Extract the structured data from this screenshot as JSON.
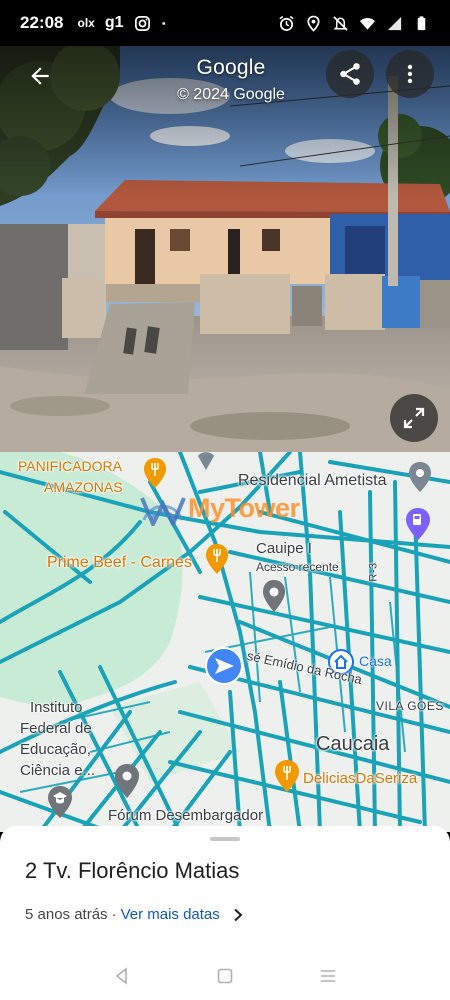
{
  "status_bar": {
    "time": "22:08",
    "apps": [
      "olx",
      "g1"
    ],
    "icons": [
      "olx-icon",
      "g1-icon",
      "instagram-icon",
      "dot-icon",
      "alarm-icon",
      "location-icon",
      "mute-icon",
      "wifi-icon",
      "signal-icon",
      "battery-icon"
    ]
  },
  "street_view": {
    "title": "Google",
    "copyright": "© 2024 Google",
    "buttons": [
      "back-arrow-icon",
      "share-icon",
      "more-vert-icon",
      "expand-icon"
    ]
  },
  "map": {
    "labels": {
      "panificadora_1": "PANIFICADORA",
      "panificadora_2": "AMAZONAS",
      "residencial": "Residencial Ametista",
      "watermark": "MyTower",
      "prime_beef": "Prime Beef - Carnes",
      "cauipe": "Cauipe I",
      "recent": "Acesso recente",
      "road_ce": "R-3",
      "casa": "Casa",
      "street": "sé Emídio da Rocha",
      "vila": "VILA GOES",
      "instituto_1": "Instituto",
      "instituto_2": "Federal de",
      "instituto_3": "Educação,",
      "instituto_4": "Ciência e...",
      "caucaia": "Caucaia",
      "delicias": "DeliciasDaSeriza",
      "forum": "Fórum Desembargador"
    }
  },
  "sheet": {
    "title": "2 Tv. Florêncio Matias",
    "ago": "5 anos atrás",
    "dot": "·",
    "link": "Ver mais datas"
  },
  "colors": {
    "road": "#1aa3b8",
    "accent_blue": "#0b57d0",
    "poi_orange": "#e37400"
  }
}
